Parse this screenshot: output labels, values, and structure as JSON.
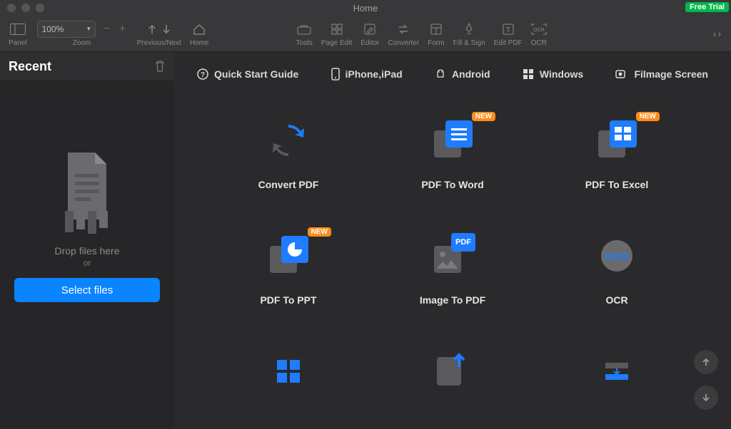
{
  "window": {
    "title": "Home",
    "free_trial": "Free Trial"
  },
  "toolbar": {
    "panel": "Panel",
    "zoom_label": "Zoom",
    "zoom_value": "100%",
    "prev_next": "Previous/Next",
    "home": "Home",
    "tools": "Tools",
    "page_edit": "Page Edit",
    "editor": "Editor",
    "converter": "Converter",
    "form": "Form",
    "fill_sign": "Fill & Sign",
    "edit_pdf": "Edit PDF",
    "ocr": "OCR"
  },
  "sidebar": {
    "heading": "Recent",
    "drop": "Drop files here",
    "or": "or",
    "select": "Select files"
  },
  "topnav": {
    "quick_start": "Quick Start Guide",
    "iphone_ipad": "iPhone,iPad",
    "android": "Android",
    "windows": "Windows",
    "filmage": "Filmage Screen"
  },
  "tiles": {
    "convert_pdf": "Convert PDF",
    "pdf_to_word": "PDF To Word",
    "pdf_to_excel": "PDF To Excel",
    "pdf_to_ppt": "PDF To PPT",
    "image_to_pdf": "Image To PDF",
    "ocr": "OCR",
    "new_badge": "NEW"
  }
}
